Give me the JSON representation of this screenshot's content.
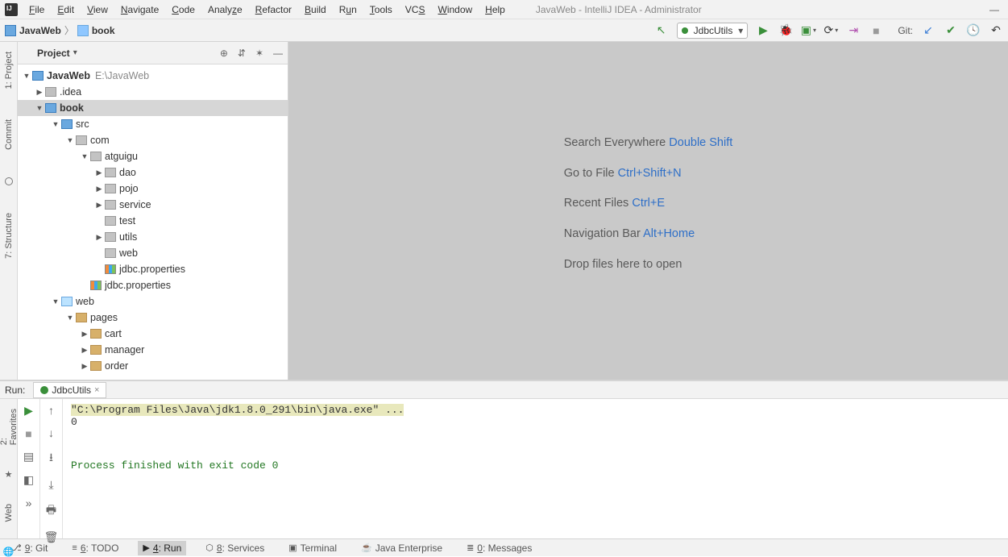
{
  "window": {
    "title": "JavaWeb - IntelliJ IDEA - Administrator"
  },
  "menu": {
    "file": "File",
    "edit": "Edit",
    "view": "View",
    "navigate": "Navigate",
    "code": "Code",
    "analyze": "Analyze",
    "refactor": "Refactor",
    "build": "Build",
    "run": "Run",
    "tools": "Tools",
    "vcs": "VCS",
    "window": "Window",
    "help": "Help"
  },
  "breadcrumb": {
    "root": "JavaWeb",
    "child": "book"
  },
  "toolbar": {
    "run_config": "JdbcUtils",
    "git_label": "Git:"
  },
  "left_tabs": {
    "project": "1: Project",
    "commit": "Commit",
    "structure": "7: Structure"
  },
  "project": {
    "title": "Project",
    "root": "JavaWeb",
    "root_path": "E:\\JavaWeb",
    "idea": ".idea",
    "book": "book",
    "src": "src",
    "com": "com",
    "atguigu": "atguigu",
    "dao": "dao",
    "pojo": "pojo",
    "service": "service",
    "test": "test",
    "utils": "utils",
    "webpkg": "web",
    "jdbc_props": "jdbc.properties",
    "jdbc_props2": "jdbc.properties",
    "webroot": "web",
    "pages": "pages",
    "cart": "cart",
    "manager": "manager",
    "order": "order"
  },
  "editor_hints": {
    "search_label": "Search Everywhere ",
    "search_key": "Double Shift",
    "goto_label": "Go to File ",
    "goto_key": "Ctrl+Shift+N",
    "recent_label": "Recent Files ",
    "recent_key": "Ctrl+E",
    "nav_label": "Navigation Bar ",
    "nav_key": "Alt+Home",
    "drop": "Drop files here to open"
  },
  "run_panel": {
    "title": "Run:",
    "tab": "JdbcUtils",
    "cmd": "\"C:\\Program Files\\Java\\jdk1.8.0_291\\bin\\java.exe\" ...",
    "out": "0",
    "exit": "Process finished with exit code 0",
    "favorites": "2: Favorites",
    "web": "Web"
  },
  "bottom": {
    "git": "9: Git",
    "todo": "6: TODO",
    "run": "4: Run",
    "services": "8: Services",
    "terminal": "Terminal",
    "java_ee": "Java Enterprise",
    "messages": "0: Messages"
  }
}
